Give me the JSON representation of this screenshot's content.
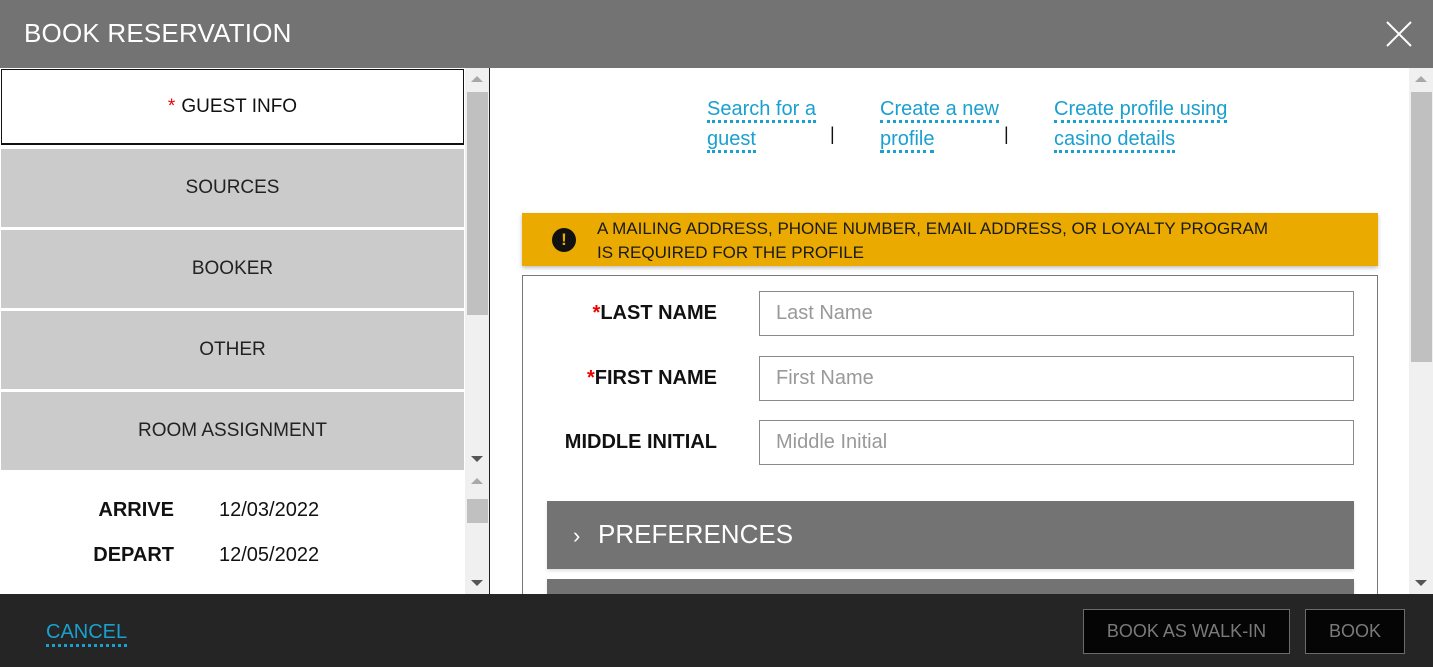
{
  "header": {
    "title": "BOOK RESERVATION",
    "close_icon": "close-icon"
  },
  "nav": {
    "items": [
      {
        "label": "GUEST INFO",
        "required": true,
        "active": true
      },
      {
        "label": "SOURCES",
        "required": false,
        "active": false
      },
      {
        "label": "BOOKER",
        "required": false,
        "active": false
      },
      {
        "label": "OTHER",
        "required": false,
        "active": false
      },
      {
        "label": "ROOM ASSIGNMENT",
        "required": false,
        "active": false
      }
    ],
    "required_marker": "*"
  },
  "stay": {
    "arrive_label": "ARRIVE",
    "arrive_value": "12/03/2022",
    "depart_label": "DEPART",
    "depart_value": "12/05/2022"
  },
  "links": {
    "search_line1": "Search for a",
    "search_line2": "guest",
    "create_line1": "Create a new",
    "create_line2": "profile",
    "casino_line1": "Create profile using",
    "casino_line2": "casino details",
    "separator": "|"
  },
  "banner": {
    "icon": "exclamation-icon",
    "line1": "A MAILING ADDRESS, PHONE NUMBER, EMAIL ADDRESS, OR LOYALTY PROGRAM",
    "line2": "IS REQUIRED FOR THE PROFILE",
    "color": "#ebaa00"
  },
  "form": {
    "required_marker": "*",
    "last_name": {
      "label": "LAST NAME",
      "placeholder": "Last Name",
      "value": ""
    },
    "first_name": {
      "label": "FIRST NAME",
      "placeholder": "First Name",
      "value": ""
    },
    "middle_initial": {
      "label": "MIDDLE INITIAL",
      "placeholder": "Middle Initial",
      "value": ""
    }
  },
  "sections": {
    "preferences": "PREFERENCES",
    "chevron": "›"
  },
  "footer": {
    "cancel": "CANCEL",
    "walk_in": "BOOK AS WALK-IN",
    "book": "BOOK"
  },
  "colors": {
    "accent": "#1aa0cf",
    "header_bg": "#737373",
    "footer_bg": "#252525",
    "required": "#ee0000"
  }
}
